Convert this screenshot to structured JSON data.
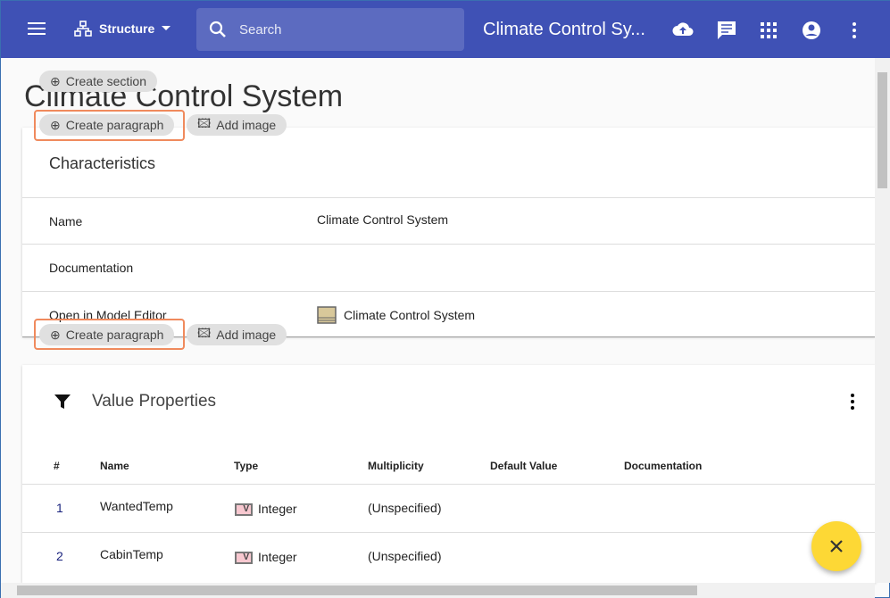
{
  "header": {
    "view_label": "Structure",
    "search_placeholder": "Search",
    "title": "Climate Control Sy..."
  },
  "page": {
    "title": "Climate Control System",
    "create_section": "Create section",
    "create_paragraph": "Create paragraph",
    "add_image": "Add image"
  },
  "characteristics": {
    "title": "Characteristics",
    "rows": [
      {
        "label": "Name",
        "value": "Climate Control System"
      },
      {
        "label": "Documentation",
        "value": ""
      },
      {
        "label": "Open in Model Editor",
        "value": "Climate Control System"
      }
    ]
  },
  "value_properties": {
    "title": "Value Properties",
    "columns": [
      "#",
      "Name",
      "Type",
      "Multiplicity",
      "Default Value",
      "Documentation"
    ],
    "rows": [
      {
        "num": "1",
        "name": "WantedTemp",
        "type_badge": "V",
        "type": "Integer",
        "multiplicity": "(Unspecified)"
      },
      {
        "num": "2",
        "name": "CabinTemp",
        "type_badge": "V",
        "type": "Integer",
        "multiplicity": "(Unspecified)"
      }
    ]
  },
  "colors": {
    "primary": "#3f51b5",
    "fab": "#fdd835",
    "highlight": "#f08a5d"
  }
}
